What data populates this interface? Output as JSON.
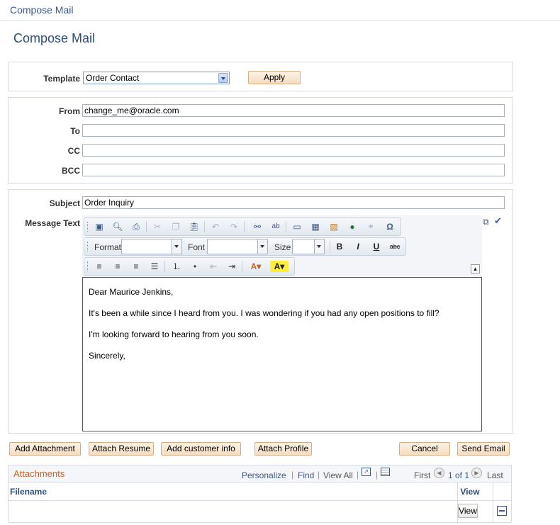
{
  "breadcrumb": "Compose Mail",
  "page_title": "Compose Mail",
  "template": {
    "label": "Template",
    "value": "Order Contact",
    "apply_label": "Apply"
  },
  "from": {
    "label": "From",
    "value": "change_me@oracle.com"
  },
  "to": {
    "label": "To",
    "value": ""
  },
  "cc": {
    "label": "CC",
    "value": ""
  },
  "bcc": {
    "label": "BCC",
    "value": ""
  },
  "subject": {
    "label": "Subject",
    "value": "Order Inquiry"
  },
  "message": {
    "label": "Message Text",
    "toolbar": {
      "format_label": "Format",
      "font_label": "Font",
      "size_label": "Size",
      "bold": "B",
      "italic": "I",
      "underline": "U",
      "strike": "abc"
    },
    "lines": [
      "Dear Maurice Jenkins,",
      "It's been a while since I heard from you.  I was wondering if you had any open positions to fill?",
      "I'm looking forward to hearing from you soon.",
      "Sincerely,"
    ]
  },
  "buttons": {
    "add_attachment": "Add Attachment",
    "attach_resume": "Attach Resume",
    "add_customer_info": "Add customer info",
    "attach_profile": "Attach Profile",
    "cancel": "Cancel",
    "send_email": "Send Email"
  },
  "attachments": {
    "title": "Attachments",
    "personalize": "Personalize",
    "find": "Find",
    "view_all": "View All",
    "first": "First",
    "count": "1 of 1",
    "last": "Last",
    "col_filename": "Filename",
    "col_view": "View",
    "row_view_button": "View"
  },
  "colors": {
    "accent": "#3a5a8c",
    "button": "#f5dcc0",
    "attachments_title": "#c0642a"
  }
}
